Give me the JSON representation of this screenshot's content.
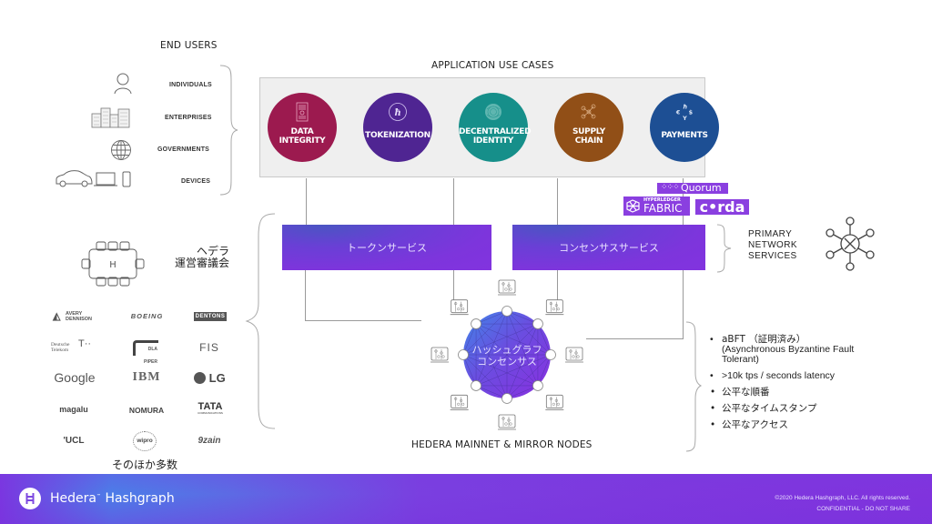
{
  "end_users": {
    "title": "END USERS",
    "items": [
      {
        "label": "INDIVIDUALS",
        "icon": "person-icon"
      },
      {
        "label": "ENTERPRISES",
        "icon": "buildings-icon"
      },
      {
        "label": "GOVERNMENTS",
        "icon": "globe-icon"
      },
      {
        "label": "DEVICES",
        "icon": "devices-icon"
      }
    ]
  },
  "use_cases": {
    "title": "APPLICATION USE CASES",
    "items": [
      {
        "label": "DATA\nINTEGRITY",
        "line1": "DATA",
        "line2": "INTEGRITY",
        "color": "#9c1a4f",
        "icon": "document-icon"
      },
      {
        "label": "TOKENIZATION",
        "line1": "TOKENIZATION",
        "line2": "",
        "color": "#4f2592",
        "icon": "hbar-token-icon"
      },
      {
        "label": "DECENTRALIZED\nIDENTITY",
        "line1": "DECENTRALIZED",
        "line2": "IDENTITY",
        "color": "#168f8a",
        "icon": "fingerprint-icon"
      },
      {
        "label": "SUPPLY\nCHAIN",
        "line1": "SUPPLY",
        "line2": "CHAIN",
        "color": "#914f17",
        "icon": "network-nodes-icon"
      },
      {
        "label": "PAYMENTS",
        "line1": "PAYMENTS",
        "line2": "",
        "color": "#1d4f94",
        "icon": "currency-exchange-icon"
      }
    ]
  },
  "integrations": {
    "quorum": "Quorum",
    "hyperledger_small": "HYPERLEDGER",
    "hyperledger_big": "FABRIC",
    "corda": "c•rda"
  },
  "services": {
    "token_service": "トークンサービス",
    "consensus_service": "コンセンサスサービス",
    "primary_label": [
      "PRIMARY",
      "NETWORK",
      "SERVICES"
    ]
  },
  "council": {
    "line1": "ヘデラ",
    "line2": "運営審議会",
    "table_letter": "H",
    "members": [
      "AVERY DENNISON",
      "BOEING",
      "DENTONS",
      "Deutsche Telekom",
      "DLA PIPER",
      "FIS",
      "Google",
      "IBM",
      "LG",
      "magalu",
      "NOMURA",
      "TATA",
      "UCL",
      "wipro",
      "zain"
    ],
    "more": "そのほか多数"
  },
  "network": {
    "center_line1": "ハッシュグラフ",
    "center_line2": "コンセンサス",
    "caption": "HEDERA MAINNET & MIRROR NODES"
  },
  "properties": [
    "aBFT （証明済み）",
    "(Asynchronous Byzantine Fault Tolerant)",
    ">10k tps / seconds latency",
    "公平な順番",
    "公平なタイムスタンプ",
    "公平なアクセス"
  ],
  "footer": {
    "brand": "Hedera",
    "brand_tm": "™",
    "brand2": "Hashgraph",
    "copyright": "©2020 Hedera Hashgraph, LLC. All rights reserved.",
    "confidential": "CONFIDENTIAL - DO NOT SHARE"
  }
}
